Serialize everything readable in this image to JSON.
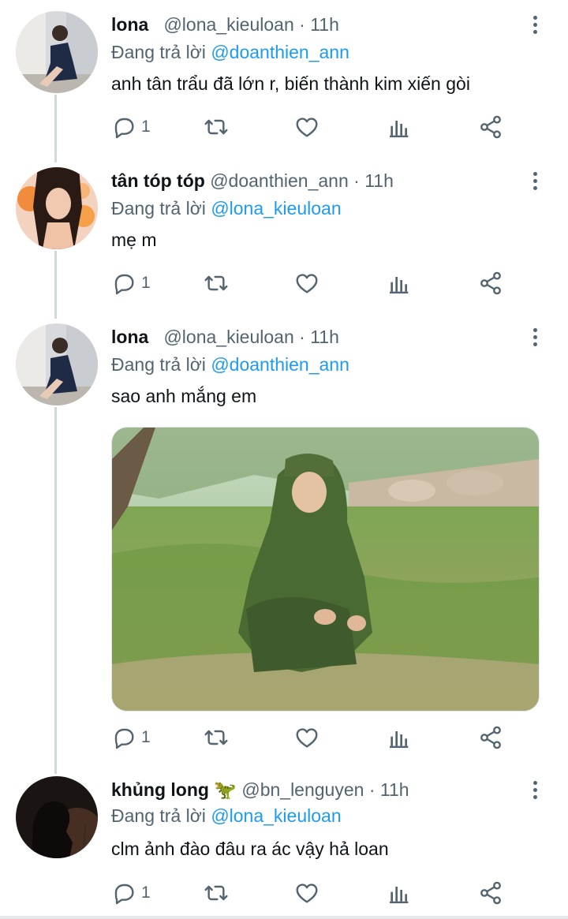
{
  "reply_prefix": "Đang trả lời",
  "tweets": [
    {
      "name": "lona",
      "handle": "@lona_kieuloan",
      "time": "· 11h",
      "replying_to": "@doanthien_ann",
      "text": "anh tân trẩu đã lớn r, biến thành kim xiến gòi",
      "reply_count": "1",
      "has_media": false
    },
    {
      "name": "tân tóp tóp",
      "handle": "@doanthien_ann",
      "time": "· 11h",
      "replying_to": "@lona_kieuloan",
      "text": "mẹ m",
      "reply_count": "1",
      "has_media": false
    },
    {
      "name": "lona",
      "handle": "@lona_kieuloan",
      "time": "· 11h",
      "replying_to": "@doanthien_ann",
      "text": "sao anh mắng em",
      "reply_count": "1",
      "has_media": true
    },
    {
      "name": "khủng long 🦖",
      "handle": "@bn_lenguyen",
      "time": "· 11h",
      "replying_to": "@lona_kieuloan",
      "text": "clm ảnh đào đâu ra ác vậy hả loan",
      "reply_count": "1",
      "has_media": false
    }
  ],
  "icons": {
    "reply": "reply-icon",
    "retweet": "retweet-icon",
    "like": "heart-icon",
    "views": "analytics-icon",
    "share": "share-icon",
    "more": "more-icon"
  },
  "colors": {
    "mention": "#1d9bf0",
    "secondary_text": "#536471",
    "thread_line": "#cfd9de"
  }
}
